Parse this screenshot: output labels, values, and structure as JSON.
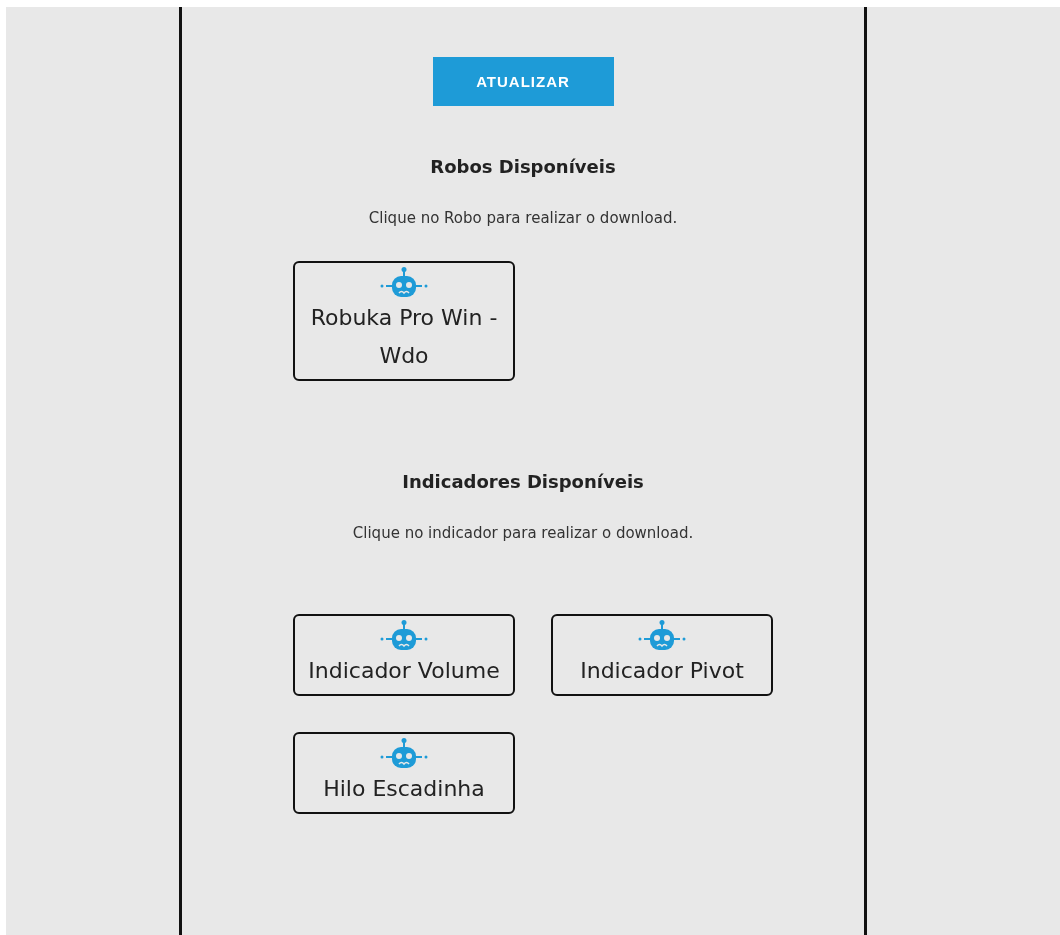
{
  "refresh_button": {
    "label": "ATUALIZAR"
  },
  "sections": [
    {
      "title": "Robos Disponíveis",
      "subtitle": "Clique no Robo para realizar o download.",
      "items": [
        {
          "label": "Robuka Pro Win - Wdo"
        }
      ]
    },
    {
      "title": "Indicadores Disponíveis",
      "subtitle": "Clique no indicador para realizar o download.",
      "items": [
        {
          "label": "Indicador Volume"
        },
        {
          "label": "Indicador Pivot"
        },
        {
          "label": "Hilo Escadinha"
        }
      ]
    }
  ]
}
